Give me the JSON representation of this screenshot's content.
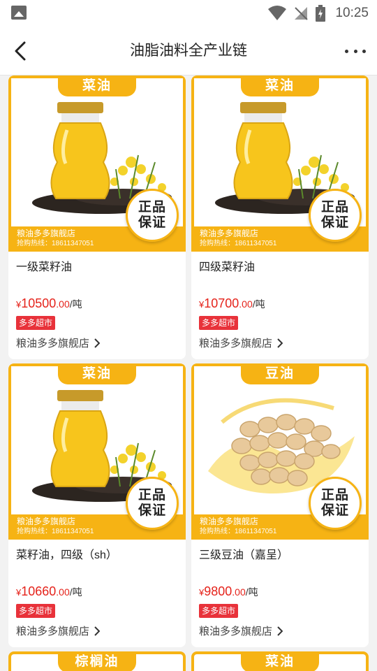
{
  "status_bar": {
    "time": "10:25"
  },
  "nav": {
    "title": "油脂油料全产业链"
  },
  "products": [
    {
      "tag": "菜油",
      "name": "一级菜籽油",
      "price_symbol": "¥",
      "price_int": "10500",
      "price_dec": ".00",
      "unit": "/吨",
      "chip": "多多超市",
      "store": "粮油多多旗舰店",
      "shop_name": "粮油多多旗舰店",
      "hotline": "抢购热线：18611347051",
      "badge_top": "正品",
      "badge_bottom": "保证",
      "image": "rapeseed-oil-jar"
    },
    {
      "tag": "菜油",
      "name": "四级菜籽油",
      "price_symbol": "¥",
      "price_int": "10700",
      "price_dec": ".00",
      "unit": "/吨",
      "chip": "多多超市",
      "store": "粮油多多旗舰店",
      "shop_name": "粮油多多旗舰店",
      "hotline": "抢购热线：18611347051",
      "badge_top": "正品",
      "badge_bottom": "保证",
      "image": "rapeseed-oil-jar"
    },
    {
      "tag": "菜油",
      "name": "菜籽油，四级（sh）",
      "price_symbol": "¥",
      "price_int": "10660",
      "price_dec": ".00",
      "unit": "/吨",
      "chip": "多多超市",
      "store": "粮油多多旗舰店",
      "shop_name": "粮油多多旗舰店",
      "hotline": "抢购热线：18611347051",
      "badge_top": "正品",
      "badge_bottom": "保证",
      "image": "rapeseed-oil-jar"
    },
    {
      "tag": "豆油",
      "name": "三级豆油（嘉呈）",
      "price_symbol": "¥",
      "price_int": "9800",
      "price_dec": ".00",
      "unit": "/吨",
      "chip": "多多超市",
      "store": "粮油多多旗舰店",
      "shop_name": "粮油多多旗舰店",
      "hotline": "抢购热线：18611347051",
      "badge_top": "正品",
      "badge_bottom": "保证",
      "image": "soybeans-oil-splash"
    }
  ],
  "partial_tags": [
    "棕榈油",
    "菜油"
  ],
  "colors": {
    "accent": "#f6b314",
    "price": "#e5231b",
    "chip": "#e8323a"
  }
}
